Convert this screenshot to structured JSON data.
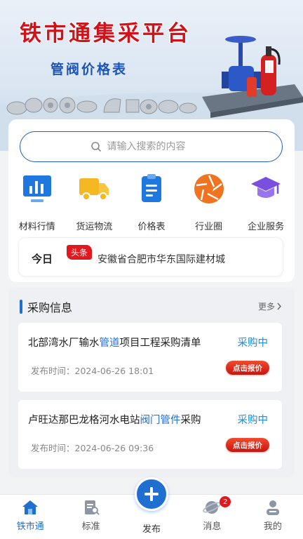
{
  "banner": {
    "title": "铁市通集采平台",
    "subtitle": "管阀价格表",
    "title_color": "#d0121b",
    "subtitle_color": "#1c55b8"
  },
  "search": {
    "placeholder": "请输入搜索的内容",
    "icon": "search-icon"
  },
  "quick_links": [
    {
      "label": "材料行情",
      "icon": "bar-chart-icon",
      "color": "#1f78e0"
    },
    {
      "label": "货运物流",
      "icon": "truck-icon",
      "color": "#f5b722"
    },
    {
      "label": "价格表",
      "icon": "clipboard-icon",
      "color": "#1f78e0"
    },
    {
      "label": "行业圈",
      "icon": "aperture-icon",
      "color": "#f0731f"
    },
    {
      "label": "企业服务",
      "icon": "graduation-cap-icon",
      "color": "#7a4fe0"
    }
  ],
  "news": {
    "today_label": "今日",
    "badge": "头条",
    "text": "安徽省合肥市华东国际建材城"
  },
  "purchase": {
    "title": "采购信息",
    "more": "更多",
    "items": [
      {
        "title_pre": "北部湾水厂输水",
        "title_hl": "管道",
        "title_post": "项目工程采购清单",
        "status": "采购中",
        "date": "发布时间：2024-06-26 18:01",
        "button": "点击报价"
      },
      {
        "title_pre": "卢旺达那巴龙格河水电站",
        "title_hl": "阀门管件",
        "title_post": "采购",
        "status": "采购中",
        "date": "发布时间：2024-06-26 09:36",
        "button": "点击报价"
      }
    ]
  },
  "nav": {
    "items": [
      {
        "label": "铁市通",
        "icon": "home-icon"
      },
      {
        "label": "标准",
        "icon": "document-search-icon"
      },
      {
        "label": "发布",
        "icon": "plus-icon"
      },
      {
        "label": "消息",
        "icon": "planet-icon",
        "badge": "2"
      },
      {
        "label": "我的",
        "icon": "user-icon"
      }
    ],
    "active_color": "#1f6fd1"
  }
}
